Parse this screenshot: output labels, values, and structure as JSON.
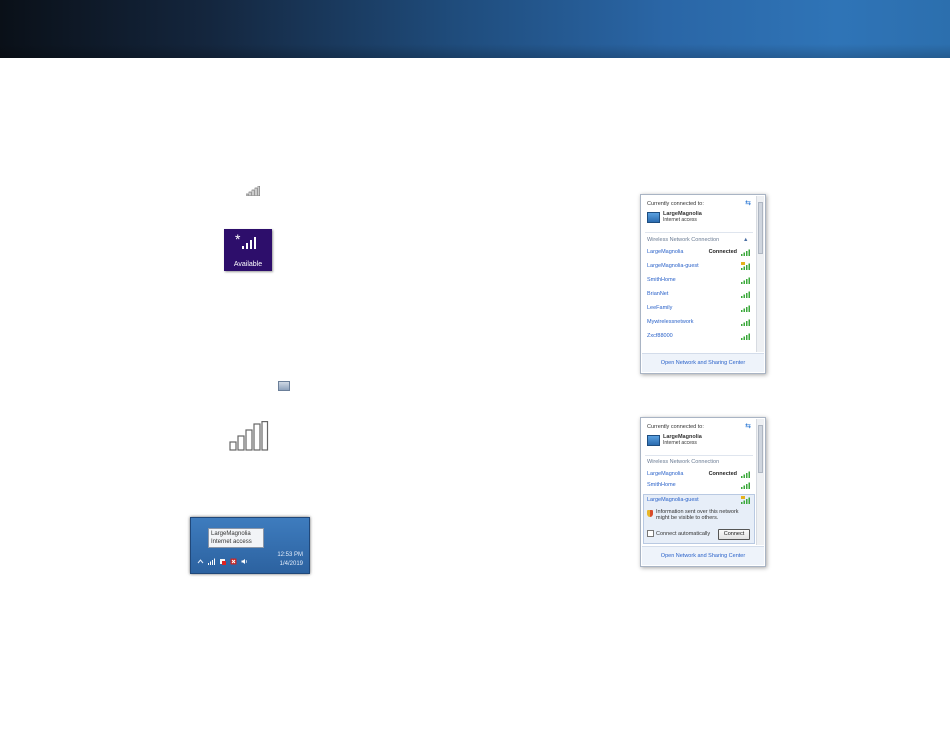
{
  "taskbar": {
    "tooltip_network": "LargeMagnolia",
    "tooltip_status": "Internet access",
    "time": "12:53 PM",
    "date": "1/4/2019"
  },
  "tile": {
    "label": "Available"
  },
  "popup1": {
    "header": "Currently connected to:",
    "current_network": "LargeMagnolia",
    "current_status": "Internet access",
    "section": "Wireless Network Connection",
    "networks": [
      {
        "name": "LargeMagnolia",
        "status": "Connected",
        "secured": true
      },
      {
        "name": "LargeMagnolia-guest",
        "status": "",
        "secured": false
      },
      {
        "name": "SmithHome",
        "status": "",
        "secured": true
      },
      {
        "name": "BrianNet",
        "status": "",
        "secured": true
      },
      {
        "name": "LeeFamily",
        "status": "",
        "secured": true
      },
      {
        "name": "Mywirelessnetwork",
        "status": "",
        "secured": true
      },
      {
        "name": "Zxcf88000",
        "status": "",
        "secured": true
      }
    ],
    "footer": "Open Network and Sharing Center"
  },
  "popup2": {
    "header": "Currently connected to:",
    "current_network": "LargeMagnolia",
    "current_status": "Internet access",
    "section": "Wireless Network Connection",
    "networks": [
      {
        "name": "LargeMagnolia",
        "status": "Connected",
        "secured": true
      },
      {
        "name": "SmithHome",
        "status": "",
        "secured": true
      }
    ],
    "expanded_network": "LargeMagnolia-guest",
    "warning_line1": "Information sent over this network",
    "warning_line2": "might be visible to others.",
    "auto_label": "Connect automatically",
    "connect_label": "Connect",
    "footer": "Open Network and Sharing Center"
  },
  "colors": {
    "banner_dark": "#0a1018",
    "banner_blue": "#2f74b7",
    "tile_bg": "#2d0e6b",
    "link_blue": "#2a62c9",
    "signal_green": "#3aa83a"
  }
}
